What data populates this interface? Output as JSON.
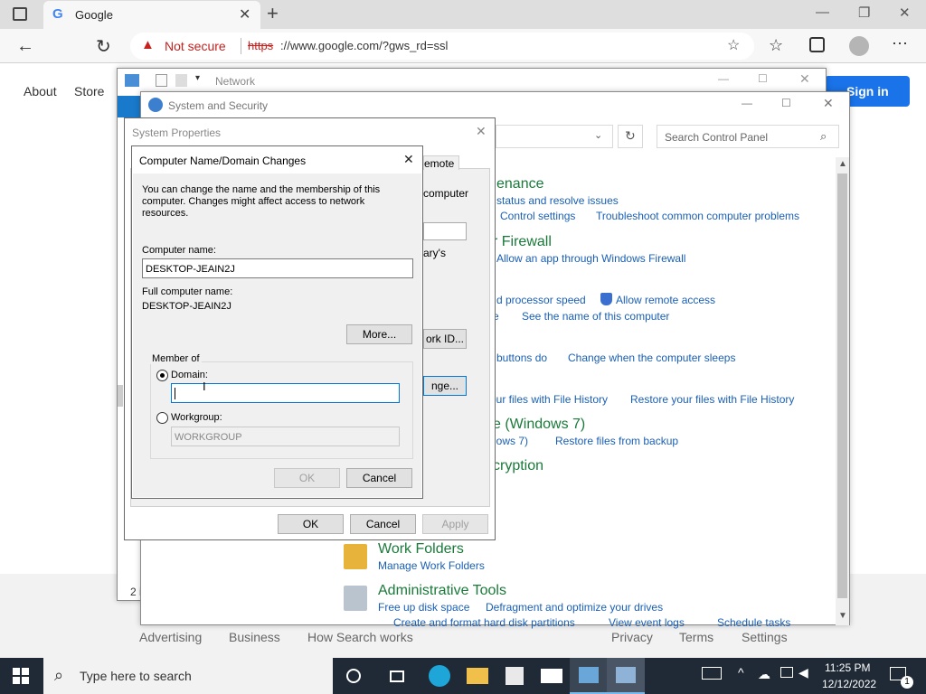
{
  "browser": {
    "tab_title": "Google",
    "not_secure": "Not secure",
    "url_scheme": "https",
    "url_rest": "://www.google.com/?gws_rd=ssl"
  },
  "google": {
    "nav_about": "About",
    "nav_store": "Store",
    "sign_in": "Sign in",
    "footer": {
      "advertising": "Advertising",
      "business": "Business",
      "how_search_works": "How Search works",
      "privacy": "Privacy",
      "terms": "Terms",
      "settings": "Settings"
    }
  },
  "network_window": {
    "title": "Network",
    "status": "2 i"
  },
  "control_panel": {
    "title": "System and Security",
    "search_placeholder": "Search Control Panel",
    "sections": {
      "maintenance_heading": "enance",
      "maintenance_link1": "status and resolve issues",
      "maintenance_link2": "Control settings",
      "maintenance_link3": "Troubleshoot common computer problems",
      "firewall_heading": "r Firewall",
      "firewall_link1": "Allow an app through Windows Firewall",
      "system_link1": "d processor speed",
      "system_link2": "Allow remote access",
      "system_link3": "e",
      "system_link4": "See the name of this computer",
      "power_link1": "buttons do",
      "power_link2": "Change when the computer sleeps",
      "history_link1": "our files with File History",
      "history_link2": "Restore your files with File History",
      "backup_heading": "e (Windows 7)",
      "backup_link1": "dows 7)",
      "backup_link2": "Restore files from backup",
      "encryption_heading": "cryption",
      "workfolders_heading": "Work Folders",
      "workfolders_link": "Manage Work Folders",
      "admin_heading": "Administrative Tools",
      "admin_link1": "Free up disk space",
      "admin_link2": "Defragment and optimize your drives",
      "admin_link3": "Create and format hard disk partitions",
      "admin_link4": "View event logs",
      "admin_link5": "Schedule tasks"
    }
  },
  "system_properties": {
    "title": "System Properties",
    "tab_remote": "emote",
    "peek_computer": "computer",
    "peek_rys": "ary's",
    "network_id_btn": "ork ID...",
    "change_btn": "nge...",
    "ok": "OK",
    "cancel": "Cancel",
    "apply": "Apply"
  },
  "domain_dialog": {
    "title": "Computer Name/Domain Changes",
    "description": "You can change the name and the membership of this computer. Changes might affect access to network resources.",
    "computer_name_label": "Computer name:",
    "computer_name_value": "DESKTOP-JEAIN2J",
    "full_name_label": "Full computer name:",
    "full_name_value": "DESKTOP-JEAIN2J",
    "more_btn": "More...",
    "member_of": "Member of",
    "domain_label": "Domain:",
    "domain_value": "",
    "workgroup_label": "Workgroup:",
    "workgroup_value": "WORKGROUP",
    "ok": "OK",
    "cancel": "Cancel"
  },
  "taskbar": {
    "search_placeholder": "Type here to search",
    "time": "11:25 PM",
    "date": "12/12/2022",
    "notification_count": "1"
  },
  "colors": {
    "accent_blue": "#1a73e8",
    "not_secure_red": "#c5221f",
    "taskbar": "#1f2a36"
  }
}
